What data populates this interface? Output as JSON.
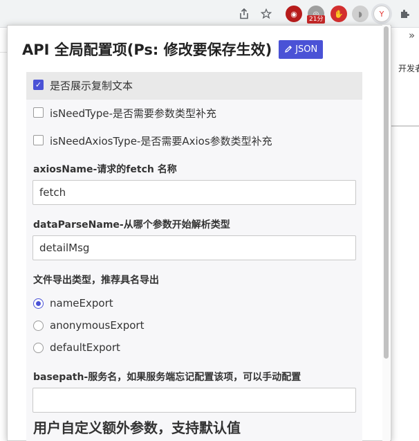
{
  "browser": {
    "share_icon": "share-icon",
    "bookmark_icon": "star-icon",
    "extensions": {
      "ext_badge": "21分",
      "puzzle_icon": "puzzle-icon"
    },
    "overflow_chevron": "»",
    "page_side_text": "开发者"
  },
  "popup": {
    "title": "API 全局配置项(Ps: 修改要保存生效)",
    "json_button": "JSON",
    "options": {
      "copy_text": {
        "label": "是否展示复制文本",
        "checked": true
      },
      "need_type": {
        "label": "isNeedType-是否需要参数类型补充",
        "checked": false
      },
      "need_axios_type": {
        "label": "isNeedAxiosType-是否需要Axios参数类型补充",
        "checked": false
      }
    },
    "axios_name": {
      "label": "axiosName-请求的fetch 名称",
      "value": "fetch"
    },
    "data_parse_name": {
      "label": "dataParseName-从哪个参数开始解析类型",
      "value": "detailMsg"
    },
    "export_type": {
      "label": "文件导出类型，推荐具名导出",
      "options": [
        "nameExport",
        "anonymousExport",
        "defaultExport"
      ],
      "selected": "nameExport"
    },
    "basepath": {
      "label": "basepath-服务名，如果服务端忘记配置该项，可以手动配置",
      "value": ""
    },
    "extra_params_title": "用户自定义额外参数，支持默认值"
  },
  "colors": {
    "accent": "#4a52d6",
    "panel_bg": "#f7f7f9",
    "highlight_row": "#e9e9e9"
  }
}
